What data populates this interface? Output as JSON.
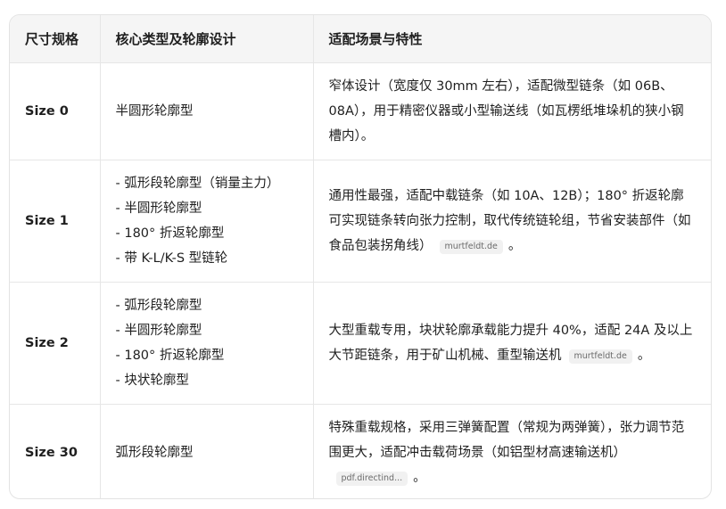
{
  "table": {
    "headers": [
      "尺寸规格",
      "核心类型及轮廓设计",
      "适配场景与特性"
    ],
    "rows": [
      {
        "size": "Size 0",
        "profiles": [
          "半圆形轮廓型"
        ],
        "features": "窄体设计（宽度仅 30mm 左右），适配微型链条（如 06B、08A），用于精密仪器或小型输送线（如瓦楞纸堆垛机的狭小钢槽内）。",
        "source": "",
        "end": ""
      },
      {
        "size": "Size 1",
        "profiles": [
          "- 弧形段轮廓型（销量主力）",
          "- 半圆形轮廓型",
          "- 180° 折返轮廓型",
          "- 带 K-L/K-S 型链轮"
        ],
        "features": "通用性最强，适配中载链条（如 10A、12B）；180° 折返轮廓可实现链条转向张力控制，取代传统链轮组，节省安装部件（如食品包装拐角线）",
        "source": "murtfeldt.de",
        "end": "。"
      },
      {
        "size": "Size 2",
        "profiles": [
          "- 弧形段轮廓型",
          "- 半圆形轮廓型",
          "- 180° 折返轮廓型",
          "- 块状轮廓型"
        ],
        "features": "大型重载专用，块状轮廓承载能力提升 40%，适配 24A 及以上大节距链条，用于矿山机械、重型输送机",
        "source": "murtfeldt.de",
        "end": "。"
      },
      {
        "size": "Size 30",
        "profiles": [
          "弧形段轮廓型"
        ],
        "features": "特殊重载规格，采用三弹簧配置（常规为两弹簧），张力调节范围更大，适配冲击载荷场景（如铝型材高速输送机）",
        "source": "pdf.directind...",
        "end": "。"
      }
    ]
  }
}
